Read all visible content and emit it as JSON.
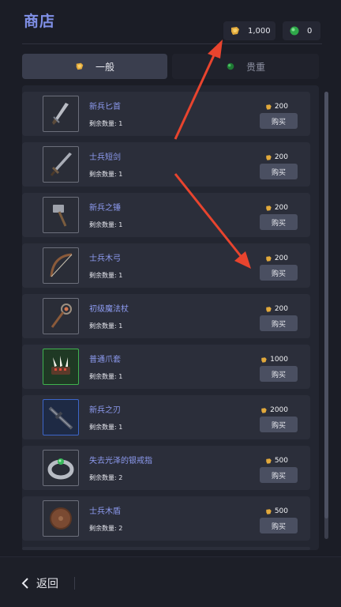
{
  "header": {
    "title": "商店",
    "gold_amount": "1,000",
    "gem_amount": "0"
  },
  "tabs": [
    {
      "label": "一般",
      "icon": "gold-coin-icon",
      "active": true
    },
    {
      "label": "贵重",
      "icon": "green-gem-icon",
      "active": false
    }
  ],
  "items": [
    {
      "name": "新兵匕首",
      "remain_label": "剩余数量:",
      "remain": "1",
      "price": "200",
      "buy_label": "购买",
      "icon": "dagger-icon"
    },
    {
      "name": "士兵短剑",
      "remain_label": "剩余数量:",
      "remain": "1",
      "price": "200",
      "buy_label": "购买",
      "icon": "sword-icon"
    },
    {
      "name": "新兵之锤",
      "remain_label": "剩余数量:",
      "remain": "1",
      "price": "200",
      "buy_label": "购买",
      "icon": "hammer-icon"
    },
    {
      "name": "士兵木弓",
      "remain_label": "剩余数量:",
      "remain": "1",
      "price": "200",
      "buy_label": "购买",
      "icon": "bow-icon"
    },
    {
      "name": "初级魔法杖",
      "remain_label": "剩余数量:",
      "remain": "1",
      "price": "200",
      "buy_label": "购买",
      "icon": "staff-icon"
    },
    {
      "name": "普通爪套",
      "remain_label": "剩余数量:",
      "remain": "1",
      "price": "1000",
      "buy_label": "购买",
      "icon": "claw-icon"
    },
    {
      "name": "新兵之刃",
      "remain_label": "剩余数量:",
      "remain": "1",
      "price": "2000",
      "buy_label": "购买",
      "icon": "blade-icon"
    },
    {
      "name": "失去光泽的银戒指",
      "remain_label": "剩余数量:",
      "remain": "2",
      "price": "500",
      "buy_label": "购买",
      "icon": "ring-icon"
    },
    {
      "name": "士兵木盾",
      "remain_label": "剩余数量:",
      "remain": "2",
      "price": "500",
      "buy_label": "购买",
      "icon": "shield-icon"
    }
  ],
  "footer": {
    "back_label": "返回"
  },
  "colors": {
    "accent": "#7f8fe6",
    "arrow": "#e8442e",
    "gold": "#e2a93b",
    "gem": "#2fa84a"
  }
}
